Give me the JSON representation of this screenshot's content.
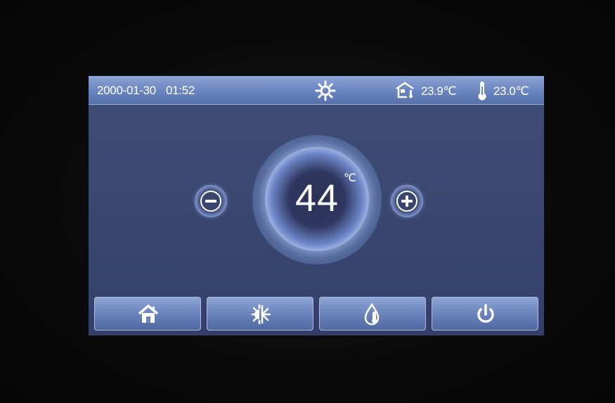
{
  "status_bar": {
    "date": "2000-01-30",
    "time": "01:52",
    "mode_icon": "sun-icon",
    "indoor_icon": "house-temperature-icon",
    "indoor_temp": "23.9℃",
    "outdoor_icon": "thermometer-icon",
    "outdoor_temp": "23.0℃"
  },
  "setpoint": {
    "value": "44",
    "unit": "℃"
  },
  "controls": {
    "decrease_icon": "minus-circle-icon",
    "increase_icon": "plus-circle-icon"
  },
  "navbar": {
    "items": [
      {
        "icon": "home-icon"
      },
      {
        "icon": "heat-cool-mode-icon"
      },
      {
        "icon": "water-temperature-icon"
      },
      {
        "icon": "power-icon"
      }
    ]
  },
  "colors": {
    "screen_bg": "#3a4770",
    "bar_top": "#8ea6d6",
    "bar_bottom": "#5670aa",
    "text": "#ffffff"
  }
}
